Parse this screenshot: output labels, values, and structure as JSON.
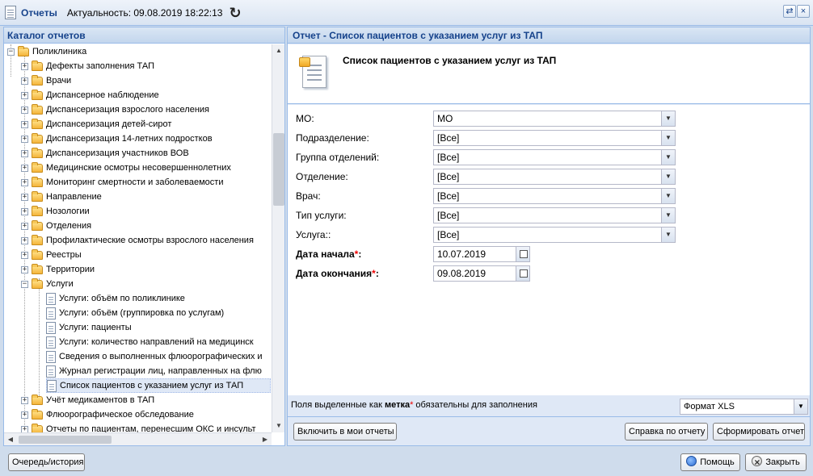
{
  "window": {
    "title": "Отчеты",
    "actuality": "Актуальность: 09.08.2019 18:22:13",
    "refresh_icon": "refresh-icon",
    "restore_icon": "restore-icon",
    "close_icon": "close-icon"
  },
  "catalog": {
    "header": "Каталог отчетов",
    "root": "Поликлиника",
    "folders": [
      "Дефекты заполнения ТАП",
      "Врачи",
      "Диспансерное наблюдение",
      "Диспансеризация взрослого населения",
      "Диспансеризация детей-сирот",
      "Диспансеризация 14-летних подростков",
      "Диспансеризация участников ВОВ",
      "Медицинские осмотры несовершеннолетних",
      "Мониторинг смертности и заболеваемости",
      "Направление",
      "Нозологии",
      "Отделения",
      "Профилактические осмотры взрослого населения",
      "Реестры",
      "Территории"
    ],
    "open_folder": "Услуги",
    "open_items": [
      "Услуги: объём по поликлинике",
      "Услуги: объём (группировка по услугам)",
      "Услуги: пациенты",
      "Услуги: количество направлений на медицинск",
      "Сведения о выполненных флюорографических и",
      "Журнал регистрации лиц, направленных на флю",
      "Список пациентов с указанием услуг из ТАП"
    ],
    "after_folders": [
      "Учёт медикаментов в ТАП",
      "Флюорографическое обследование",
      "Отчеты по пациентам, перенесшим ОКС и инсульт"
    ]
  },
  "report": {
    "header": "Отчет - Список пациентов с указанием услуг из ТАП",
    "title": "Список пациентов с указанием услуг из ТАП",
    "fields": [
      {
        "label": "МО:",
        "value": "МО"
      },
      {
        "label": "Подразделение:",
        "value": "[Все]"
      },
      {
        "label": "Группа отделений:",
        "value": "[Все]"
      },
      {
        "label": "Отделение:",
        "value": "[Все]"
      },
      {
        "label": "Врач:",
        "value": "[Все]"
      },
      {
        "label": "Тип услуги:",
        "value": "[Все]"
      },
      {
        "label": "Услуга::",
        "value": "[Все]"
      }
    ],
    "date_start": {
      "label": "Дата начала",
      "value": "10.07.2019"
    },
    "date_end": {
      "label": "Дата окончания",
      "value": "09.08.2019"
    },
    "required_mark": "*",
    "required_note_prefix": "Поля выделенные как",
    "required_note_bold": "метка",
    "required_note_suffix": "обязательны для заполнения",
    "format": "Формат XLS",
    "buttons": {
      "add_to_my": "Включить в мои отчеты",
      "help": "Справка по отчету",
      "generate": "Сформировать отчет"
    }
  },
  "footer": {
    "queue": "Очередь/история",
    "help": "Помощь",
    "close": "Закрыть"
  }
}
